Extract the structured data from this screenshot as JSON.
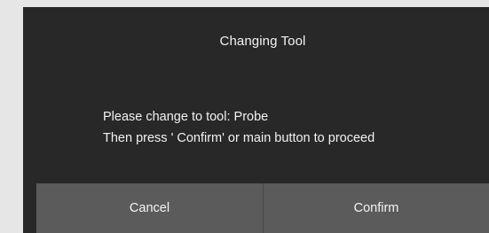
{
  "dialog": {
    "title": "Changing Tool",
    "message_line1": "Please change to tool: Probe",
    "message_line2": "Then press ' Confirm' or main button to proceed",
    "cancel_label": "Cancel",
    "confirm_label": "Confirm"
  },
  "colors": {
    "background": "#e6e6e6",
    "dialog": "#282828",
    "button": "#5b5b5b",
    "text": "#f2f2f2"
  }
}
